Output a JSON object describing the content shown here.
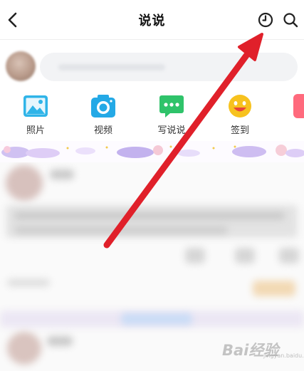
{
  "header": {
    "title": "说说",
    "back_icon": "chevron-left-icon",
    "history_icon": "clock-icon",
    "search_icon": "search-icon"
  },
  "composer": {
    "avatar": "avatar",
    "placeholder": ""
  },
  "actions": [
    {
      "label": "照片",
      "icon": "photo-icon",
      "color": "#2fb4e8"
    },
    {
      "label": "视频",
      "icon": "camera-icon",
      "color": "#24a9e6"
    },
    {
      "label": "写说说",
      "icon": "speech-bubble-icon",
      "color": "#2fc36a"
    },
    {
      "label": "签到",
      "icon": "smiley-icon",
      "color": "#f7c21e"
    }
  ],
  "annotation": {
    "arrow_color": "#e0202a"
  },
  "watermark": {
    "text": "Bai经验",
    "sub": "jingyan.baidu.com"
  },
  "colors": {
    "accent": "#2fb4e8",
    "arrow": "#e0202a",
    "divider": "#eeeeee"
  }
}
